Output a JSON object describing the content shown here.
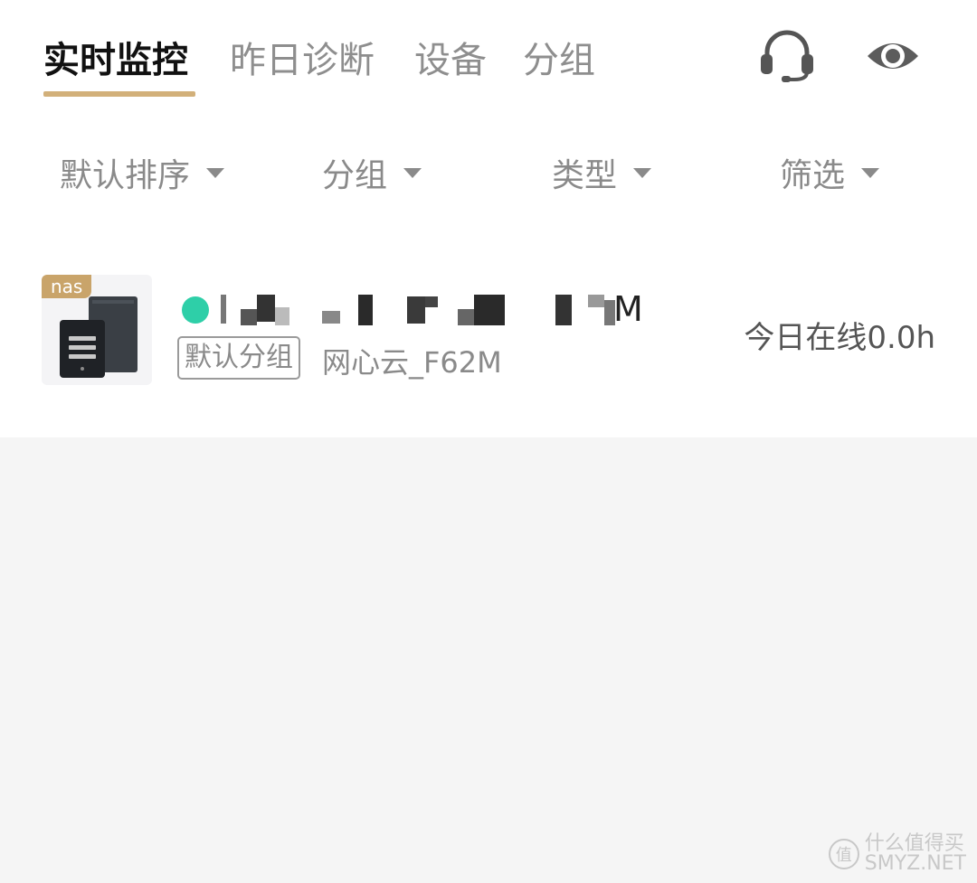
{
  "tabs": [
    {
      "label": "实时监控",
      "active": true
    },
    {
      "label": "昨日诊断",
      "active": false
    },
    {
      "label": "设备",
      "active": false
    },
    {
      "label": "分组",
      "active": false
    }
  ],
  "header_icons": [
    "headset-icon",
    "eye-icon"
  ],
  "filters": [
    {
      "label": "默认排序"
    },
    {
      "label": "分组"
    },
    {
      "label": "类型"
    },
    {
      "label": "筛选"
    }
  ],
  "device": {
    "badge": "nas",
    "name_suffix": "M",
    "status": "online",
    "group_tag": "默认分组",
    "model": "网心云_F62M",
    "online_time": "今日在线0.0h"
  },
  "watermark": {
    "glyph": "值",
    "line1": "什么值得买",
    "line2": "SMYZ.NET"
  },
  "colors": {
    "accent": "#d2b07a",
    "badge": "#c9a46a",
    "online_dot": "#2ecfa8",
    "background": "#f5f5f5"
  }
}
